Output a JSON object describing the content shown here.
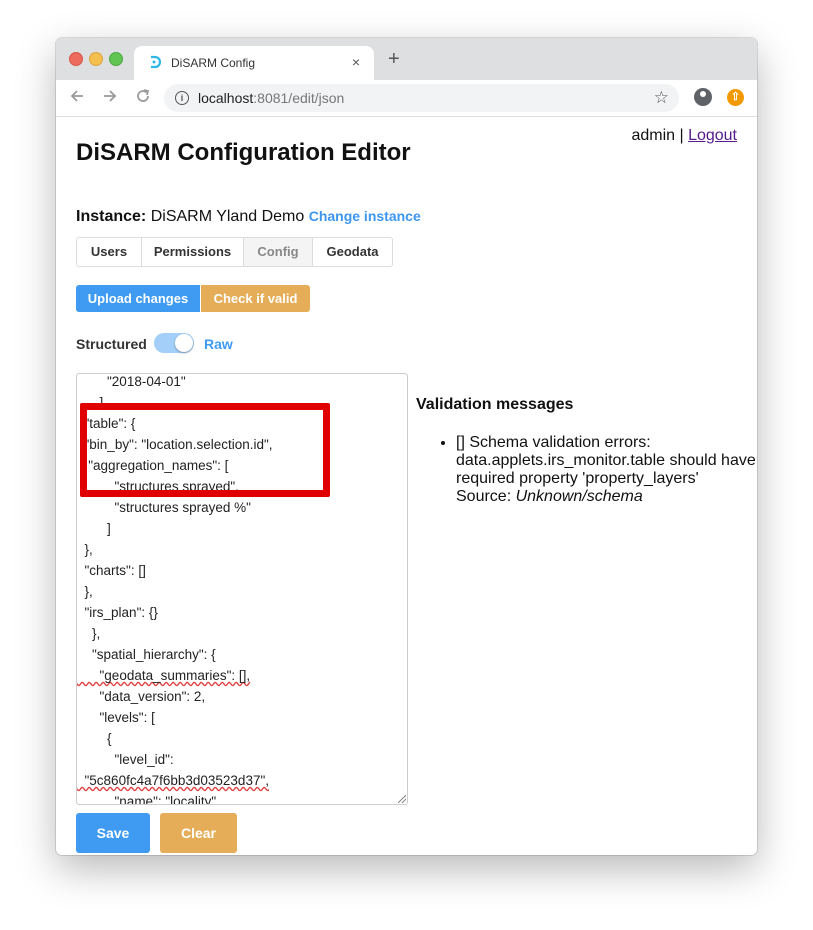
{
  "browser": {
    "tab_title": "DiSARM Config",
    "url_host": "localhost",
    "url_rest": ":8081/edit/json",
    "tab_close": "×",
    "new_tab": "+",
    "info_glyph": "i",
    "star_glyph": "☆",
    "ext_glyph": "⇧"
  },
  "header": {
    "username": "admin",
    "separator": " | ",
    "logout": "Logout",
    "title": "DiSARM Configuration Editor"
  },
  "instance": {
    "label": "Instance:",
    "name": "DiSARM Yland Demo",
    "change": "Change instance"
  },
  "nav_tabs": [
    "Users",
    "Permissions",
    "Config",
    "Geodata"
  ],
  "actions": {
    "upload": "Upload changes",
    "check": "Check if valid",
    "save": "Save",
    "clear": "Clear"
  },
  "toggle": {
    "structured": "Structured",
    "raw": "Raw",
    "mode": "raw"
  },
  "editor_lines": [
    "        \"2018-04-01\"",
    "      ],",
    "  \"table\": {",
    "  \"bin_by\": \"location.selection.id\",",
    "   \"aggregation_names\": [",
    "          \"structures sprayed\",",
    "          \"structures sprayed %\"",
    "        ]",
    "  },",
    "  \"charts\": []",
    "  },",
    "  \"irs_plan\": {}",
    "    },",
    "    \"spatial_hierarchy\": {",
    "      \"geodata_summaries\": [],",
    "      \"data_version\": 2,",
    "      \"levels\": [",
    "        {",
    "          \"level_id\":",
    "  \"5c860fc4a7f6bb3d03523d37\",",
    "          \"name\": \"locality\","
  ],
  "validation": {
    "title": "Validation messages",
    "message": "[] Schema validation errors: data.applets.irs_monitor.table should have required property 'property_layers' Source:",
    "source": "Unknown/schema"
  },
  "colors": {
    "primary": "#3f9bf2",
    "warning": "#e5ad57",
    "highlight": "#e00000"
  }
}
